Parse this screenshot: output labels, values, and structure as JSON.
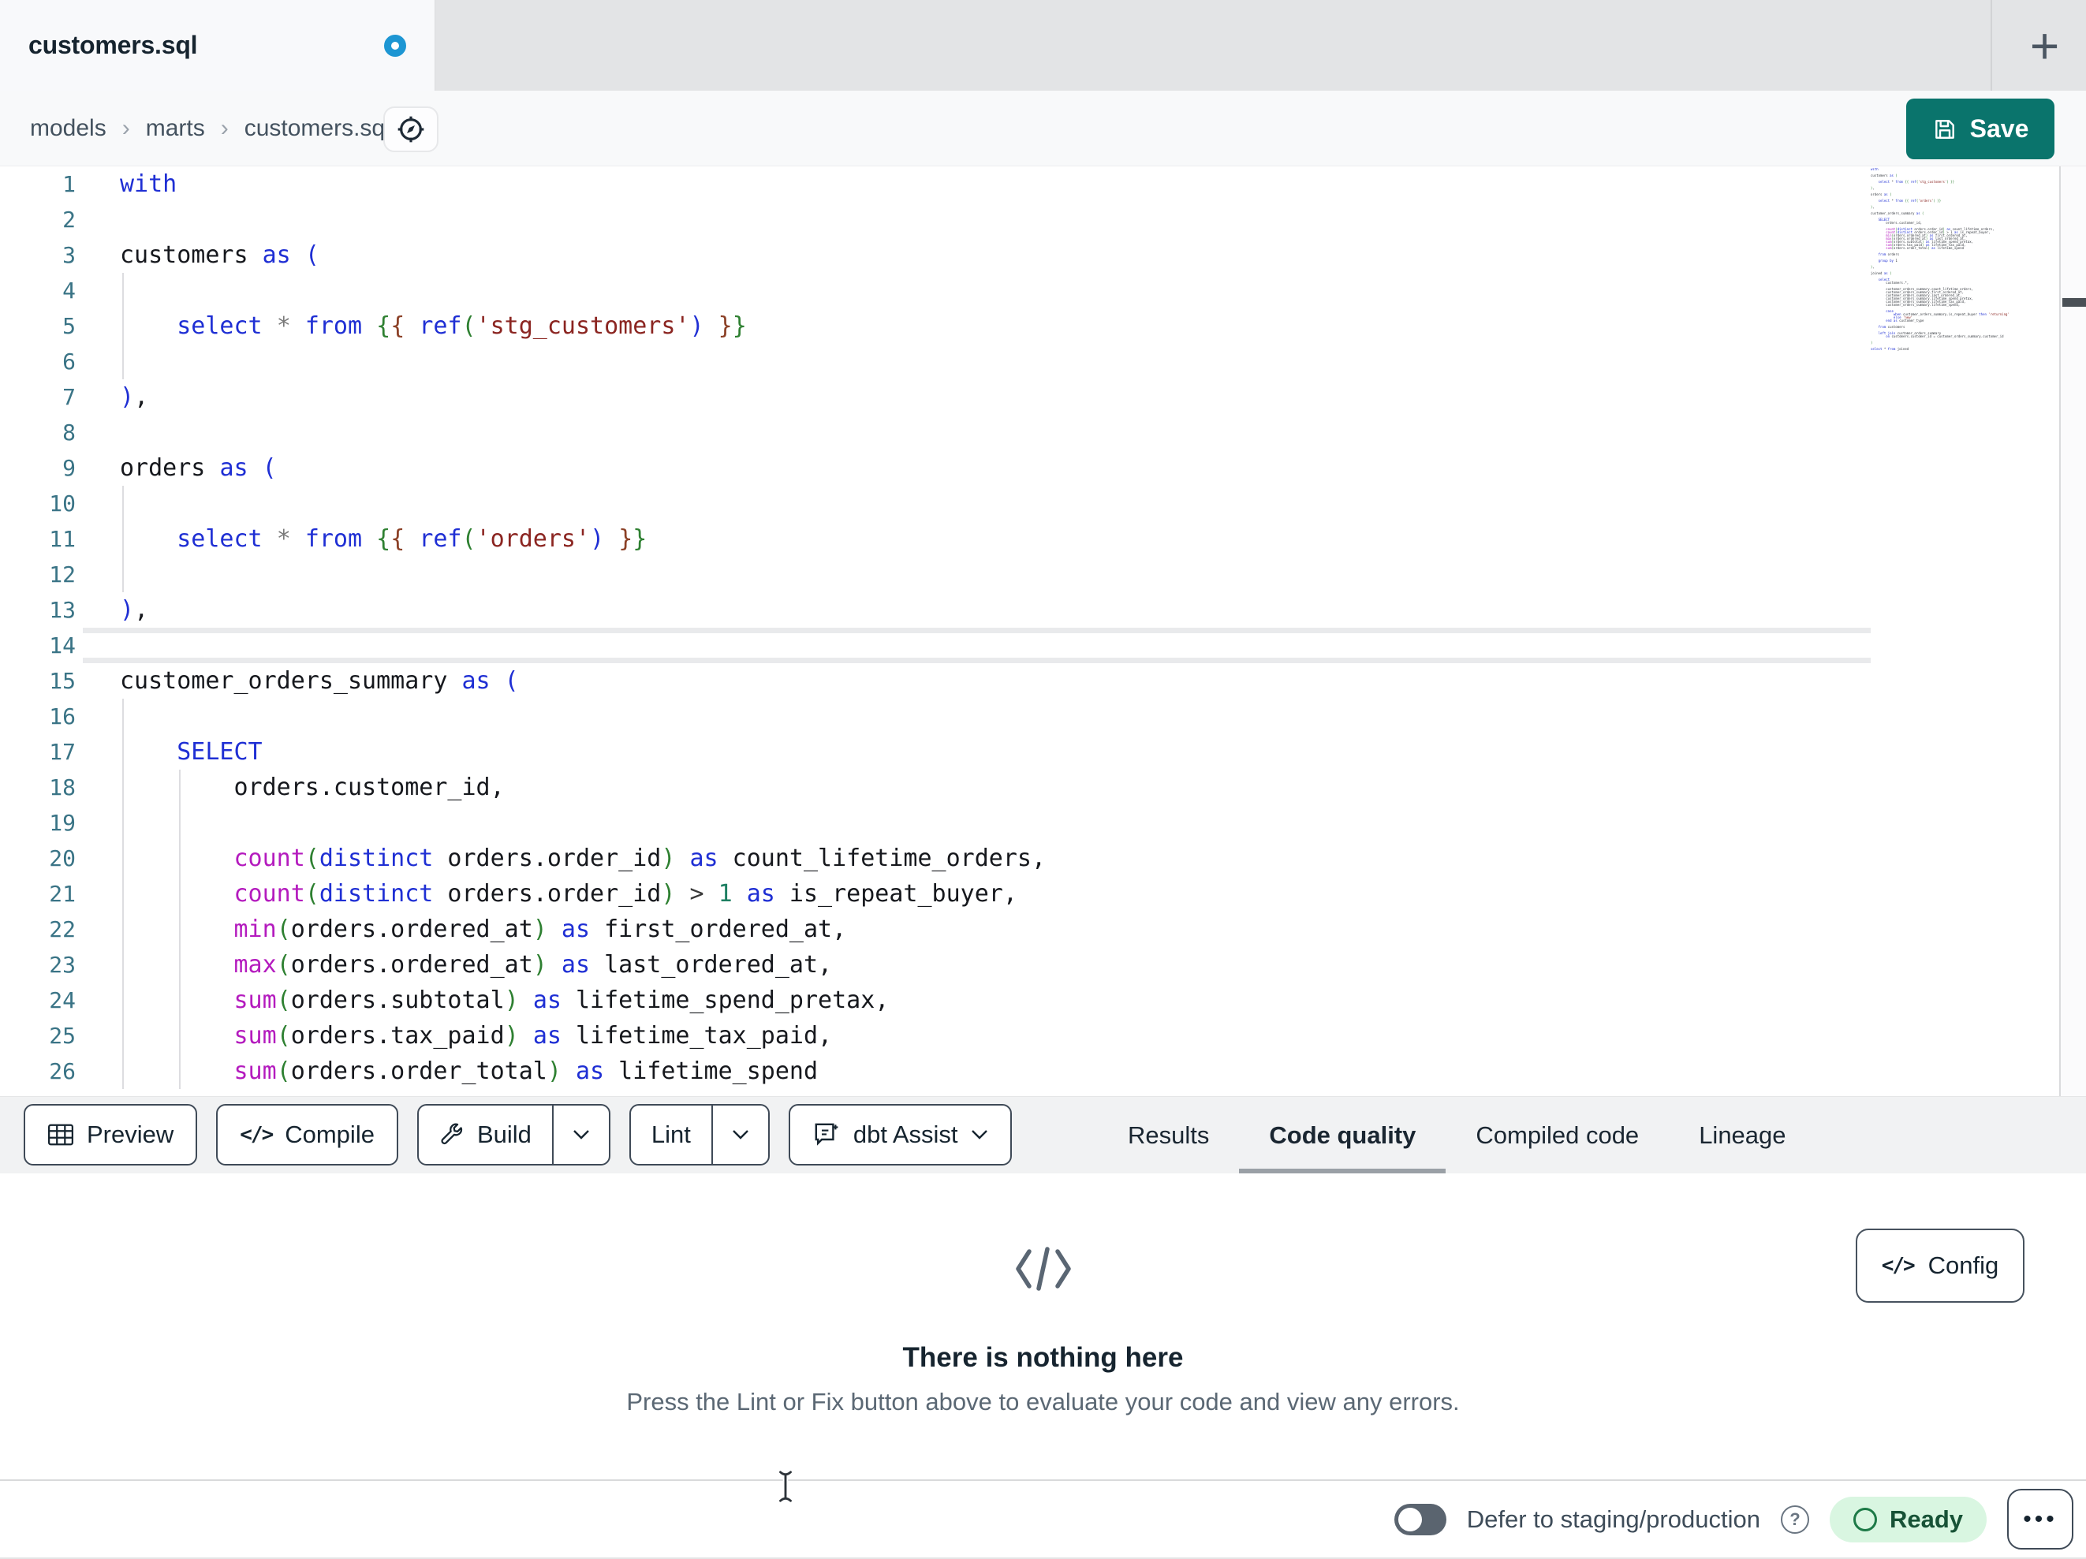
{
  "colors": {
    "accent_teal": "#0a746c",
    "unsaved_dot": "#1d96d3",
    "ready_bg": "#d9f6e1",
    "ready_ring": "#1d7a47",
    "syntax": {
      "k": "#1f2fd4",
      "f": "#b41bbe",
      "s": "#8b2521",
      "g": "#2e8031",
      "b": "#8b4026",
      "o": "#7a7a7a",
      "t": "#3a3a3a",
      "n": "#1d7f62",
      "p": "#16181d",
      "ln": "#3a7486"
    }
  },
  "icons": {
    "new_tab": "+",
    "code_glyph": "</>",
    "overflow_dots": "•••",
    "crumb_separator": "›",
    "help_glyph": "?"
  },
  "tabbar": {
    "tab_title": "customers.sql"
  },
  "breadcrumb": {
    "items": [
      "models",
      "marts",
      "customers.sql"
    ]
  },
  "save": {
    "label": "Save"
  },
  "toolbar": {
    "preview": "Preview",
    "compile": "Compile",
    "build": "Build",
    "lint": "Lint",
    "assist": "dbt Assist"
  },
  "result_tabs": [
    {
      "label": "Results",
      "active": false
    },
    {
      "label": "Code quality",
      "active": true
    },
    {
      "label": "Compiled code",
      "active": false
    },
    {
      "label": "Lineage",
      "active": false
    }
  ],
  "panel": {
    "config_label": "Config",
    "empty_title": "There is nothing here",
    "empty_subtitle": "Press the Lint or Fix button above to evaluate your code and view any errors."
  },
  "statusbar": {
    "defer_label": "Defer to staging/production",
    "ready_label": "Ready"
  },
  "editor": {
    "current_line": 14,
    "lines": [
      {
        "n": 1,
        "t": [
          [
            "with",
            "k"
          ]
        ]
      },
      {
        "n": 2,
        "t": []
      },
      {
        "n": 3,
        "t": [
          [
            "customers ",
            "p"
          ],
          [
            "as",
            "k"
          ],
          [
            " ",
            "p"
          ],
          [
            "(",
            "k"
          ]
        ]
      },
      {
        "n": 4,
        "g": [
          0
        ],
        "t": []
      },
      {
        "n": 5,
        "g": [
          0
        ],
        "t": [
          [
            "    ",
            "p"
          ],
          [
            "select",
            "k"
          ],
          [
            " ",
            "p"
          ],
          [
            "*",
            "o"
          ],
          [
            " ",
            "p"
          ],
          [
            "from",
            "k"
          ],
          [
            " ",
            "p"
          ],
          [
            "{",
            "g"
          ],
          [
            "{",
            "b"
          ],
          [
            " ",
            "p"
          ],
          [
            "ref",
            "k"
          ],
          [
            "(",
            "g"
          ],
          [
            "'stg_customers'",
            "s"
          ],
          [
            ")",
            "k"
          ],
          [
            " ",
            "p"
          ],
          [
            "}",
            "b"
          ],
          [
            "}",
            "g"
          ]
        ]
      },
      {
        "n": 6,
        "g": [
          0
        ],
        "t": []
      },
      {
        "n": 7,
        "t": [
          [
            ")",
            "k"
          ],
          [
            ",",
            "p"
          ]
        ]
      },
      {
        "n": 8,
        "t": []
      },
      {
        "n": 9,
        "t": [
          [
            "orders ",
            "p"
          ],
          [
            "as",
            "k"
          ],
          [
            " ",
            "p"
          ],
          [
            "(",
            "k"
          ]
        ]
      },
      {
        "n": 10,
        "g": [
          0
        ],
        "t": []
      },
      {
        "n": 11,
        "g": [
          0
        ],
        "t": [
          [
            "    ",
            "p"
          ],
          [
            "select",
            "k"
          ],
          [
            " ",
            "p"
          ],
          [
            "*",
            "o"
          ],
          [
            " ",
            "p"
          ],
          [
            "from",
            "k"
          ],
          [
            " ",
            "p"
          ],
          [
            "{",
            "g"
          ],
          [
            "{",
            "b"
          ],
          [
            " ",
            "p"
          ],
          [
            "ref",
            "k"
          ],
          [
            "(",
            "g"
          ],
          [
            "'orders'",
            "s"
          ],
          [
            ")",
            "k"
          ],
          [
            " ",
            "p"
          ],
          [
            "}",
            "b"
          ],
          [
            "}",
            "g"
          ]
        ]
      },
      {
        "n": 12,
        "g": [
          0
        ],
        "t": []
      },
      {
        "n": 13,
        "t": [
          [
            ")",
            "k"
          ],
          [
            ",",
            "p"
          ]
        ]
      },
      {
        "n": 14,
        "cur": true,
        "t": []
      },
      {
        "n": 15,
        "t": [
          [
            "customer_orders_summary ",
            "p"
          ],
          [
            "as",
            "k"
          ],
          [
            " ",
            "p"
          ],
          [
            "(",
            "k"
          ]
        ]
      },
      {
        "n": 16,
        "g": [
          0
        ],
        "t": []
      },
      {
        "n": 17,
        "g": [
          0
        ],
        "t": [
          [
            "    ",
            "p"
          ],
          [
            "SELECT",
            "k"
          ]
        ]
      },
      {
        "n": 18,
        "g": [
          0,
          1
        ],
        "t": [
          [
            "        orders.customer_id,",
            "p"
          ]
        ]
      },
      {
        "n": 19,
        "g": [
          0,
          1
        ],
        "t": []
      },
      {
        "n": 20,
        "g": [
          0,
          1
        ],
        "t": [
          [
            "        ",
            "p"
          ],
          [
            "count",
            "f"
          ],
          [
            "(",
            "g"
          ],
          [
            "distinct",
            "k"
          ],
          [
            " orders.order_id",
            "p"
          ],
          [
            ")",
            "g"
          ],
          [
            " ",
            "p"
          ],
          [
            "as",
            "k"
          ],
          [
            " count_lifetime_orders,",
            "p"
          ]
        ]
      },
      {
        "n": 21,
        "g": [
          0,
          1
        ],
        "t": [
          [
            "        ",
            "p"
          ],
          [
            "count",
            "f"
          ],
          [
            "(",
            "g"
          ],
          [
            "distinct",
            "k"
          ],
          [
            " orders.order_id",
            "p"
          ],
          [
            ")",
            "g"
          ],
          [
            " ",
            "p"
          ],
          [
            ">",
            "t"
          ],
          [
            " ",
            "p"
          ],
          [
            "1",
            "n"
          ],
          [
            " ",
            "p"
          ],
          [
            "as",
            "k"
          ],
          [
            " is_repeat_buyer,",
            "p"
          ]
        ]
      },
      {
        "n": 22,
        "g": [
          0,
          1
        ],
        "t": [
          [
            "        ",
            "p"
          ],
          [
            "min",
            "f"
          ],
          [
            "(",
            "g"
          ],
          [
            "orders.ordered_at",
            "p"
          ],
          [
            ")",
            "g"
          ],
          [
            " ",
            "p"
          ],
          [
            "as",
            "k"
          ],
          [
            " first_ordered_at,",
            "p"
          ]
        ]
      },
      {
        "n": 23,
        "g": [
          0,
          1
        ],
        "t": [
          [
            "        ",
            "p"
          ],
          [
            "max",
            "f"
          ],
          [
            "(",
            "g"
          ],
          [
            "orders.ordered_at",
            "p"
          ],
          [
            ")",
            "g"
          ],
          [
            " ",
            "p"
          ],
          [
            "as",
            "k"
          ],
          [
            " last_ordered_at,",
            "p"
          ]
        ]
      },
      {
        "n": 24,
        "g": [
          0,
          1
        ],
        "t": [
          [
            "        ",
            "p"
          ],
          [
            "sum",
            "f"
          ],
          [
            "(",
            "g"
          ],
          [
            "orders.subtotal",
            "p"
          ],
          [
            ")",
            "g"
          ],
          [
            " ",
            "p"
          ],
          [
            "as",
            "k"
          ],
          [
            " lifetime_spend_pretax,",
            "p"
          ]
        ]
      },
      {
        "n": 25,
        "g": [
          0,
          1
        ],
        "t": [
          [
            "        ",
            "p"
          ],
          [
            "sum",
            "f"
          ],
          [
            "(",
            "g"
          ],
          [
            "orders.tax_paid",
            "p"
          ],
          [
            ")",
            "g"
          ],
          [
            " ",
            "p"
          ],
          [
            "as",
            "k"
          ],
          [
            " lifetime_tax_paid,",
            "p"
          ]
        ]
      },
      {
        "n": 26,
        "g": [
          0,
          1
        ],
        "t": [
          [
            "        ",
            "p"
          ],
          [
            "sum",
            "f"
          ],
          [
            "(",
            "g"
          ],
          [
            "orders.order_total",
            "p"
          ],
          [
            ")",
            "g"
          ],
          [
            " ",
            "p"
          ],
          [
            "as",
            "k"
          ],
          [
            " lifetime_spend",
            "p"
          ]
        ]
      }
    ]
  },
  "minimap": {
    "lines": [
      "with",
      "",
      "customers as (",
      "",
      "    select * from {{ ref('stg_customers') }}",
      "",
      "),",
      "",
      "orders as (",
      "",
      "    select * from {{ ref('orders') }}",
      "",
      "),",
      "",
      "customer_orders_summary as (",
      "",
      "    SELECT",
      "        orders.customer_id,",
      "",
      "        count(distinct orders.order_id) as count_lifetime_orders,",
      "        count(distinct orders.order_id) > 1 as is_repeat_buyer,",
      "        min(orders.ordered_at) as first_ordered_at,",
      "        max(orders.ordered_at) as last_ordered_at,",
      "        sum(orders.subtotal) as lifetime_spend_pretax,",
      "        sum(orders.tax_paid) as lifetime_tax_paid,",
      "        sum(orders.order_total) as lifetime_spend",
      "",
      "    from orders",
      "",
      "    group by 1",
      "",
      "),",
      "",
      "joined as (",
      "",
      "    select",
      "        customers.*,",
      "",
      "        customer_orders_summary.count_lifetime_orders,",
      "        customer_orders_summary.first_ordered_at,",
      "        customer_orders_summary.last_ordered_at,",
      "        customer_orders_summary.lifetime_spend_pretax,",
      "        customer_orders_summary.lifetime_tax_paid,",
      "        customer_orders_summary.lifetime_spend,",
      "",
      "        case",
      "            when customer_orders_summary.is_repeat_buyer then 'returning'",
      "            else 'new'",
      "        end as customer_type",
      "",
      "    from customers",
      "",
      "    left join customer_orders_summary",
      "        on customers.customer_id = customer_orders_summary.customer_id",
      "",
      ")",
      "",
      "select * from joined"
    ]
  }
}
